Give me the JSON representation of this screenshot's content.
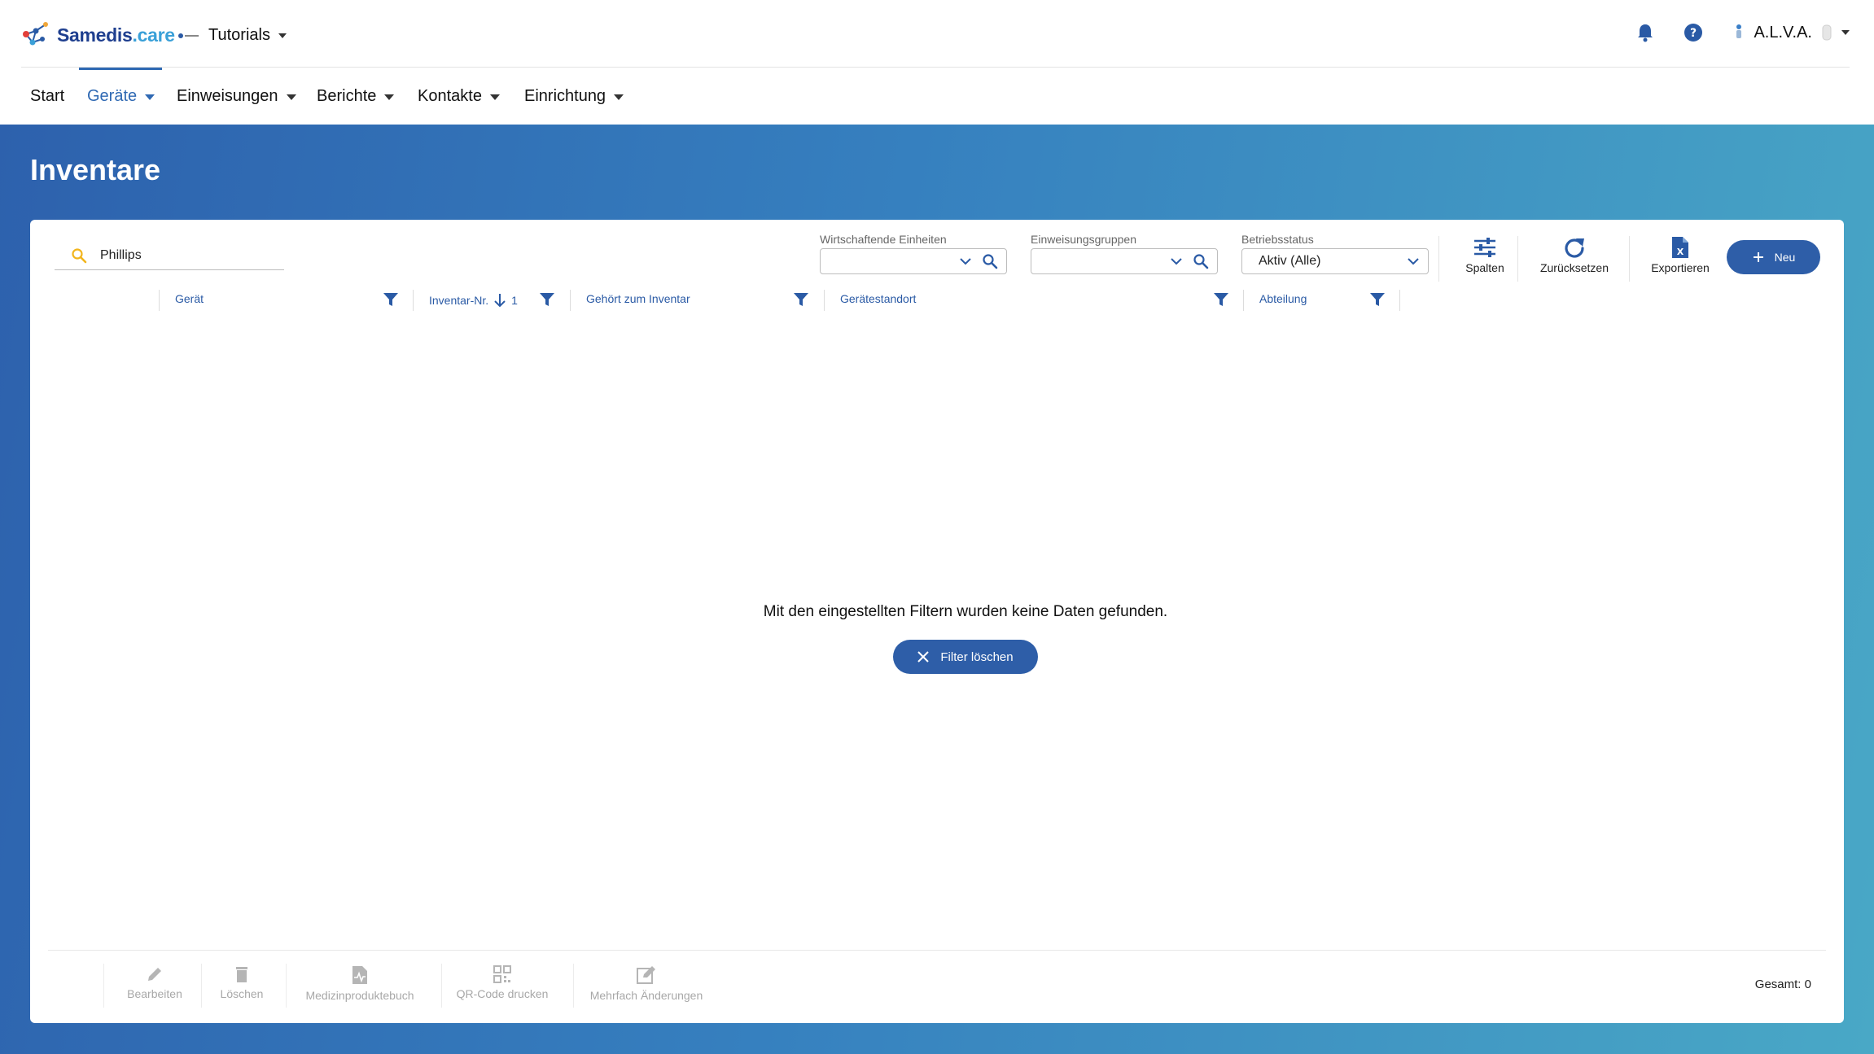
{
  "header": {
    "logo_part1": "Samedis",
    "logo_part2": ".care",
    "tenant": "Tutorials",
    "user": "A.L.V.A."
  },
  "nav": {
    "items": [
      {
        "label": "Start"
      },
      {
        "label": "Geräte"
      },
      {
        "label": "Einweisungen"
      },
      {
        "label": "Berichte"
      },
      {
        "label": "Kontakte"
      },
      {
        "label": "Einrichtung"
      }
    ],
    "active": "Geräte"
  },
  "page": {
    "title": "Inventare"
  },
  "search": {
    "value": "Phillips"
  },
  "filters": {
    "units_label": "Wirtschaftende Einheiten",
    "groups_label": "Einweisungsgruppen",
    "status_label": "Betriebsstatus",
    "status_value": "Aktiv (Alle)"
  },
  "tools": {
    "columns": "Spalten",
    "reset": "Zurücksetzen",
    "export": "Exportieren",
    "new": "Neu"
  },
  "table": {
    "columns": [
      "Gerät",
      "Inventar-Nr.",
      "Gehört zum Inventar",
      "Gerätestandort",
      "Abteilung"
    ],
    "sort_index": "1",
    "empty_message": "Mit den eingestellten Filtern wurden keine Daten gefunden.",
    "clear_filter": "Filter löschen"
  },
  "actions": [
    "Bearbeiten",
    "Löschen",
    "Medizinproduktebuch",
    "QR-Code drucken",
    "Mehrfach Änderungen"
  ],
  "footer": {
    "total": "Gesamt: 0"
  },
  "colors": {
    "primary": "#2e5ea8",
    "link": "#2a5aa5",
    "hero_start": "#2d61ad",
    "hero_end": "#49a8c6"
  }
}
